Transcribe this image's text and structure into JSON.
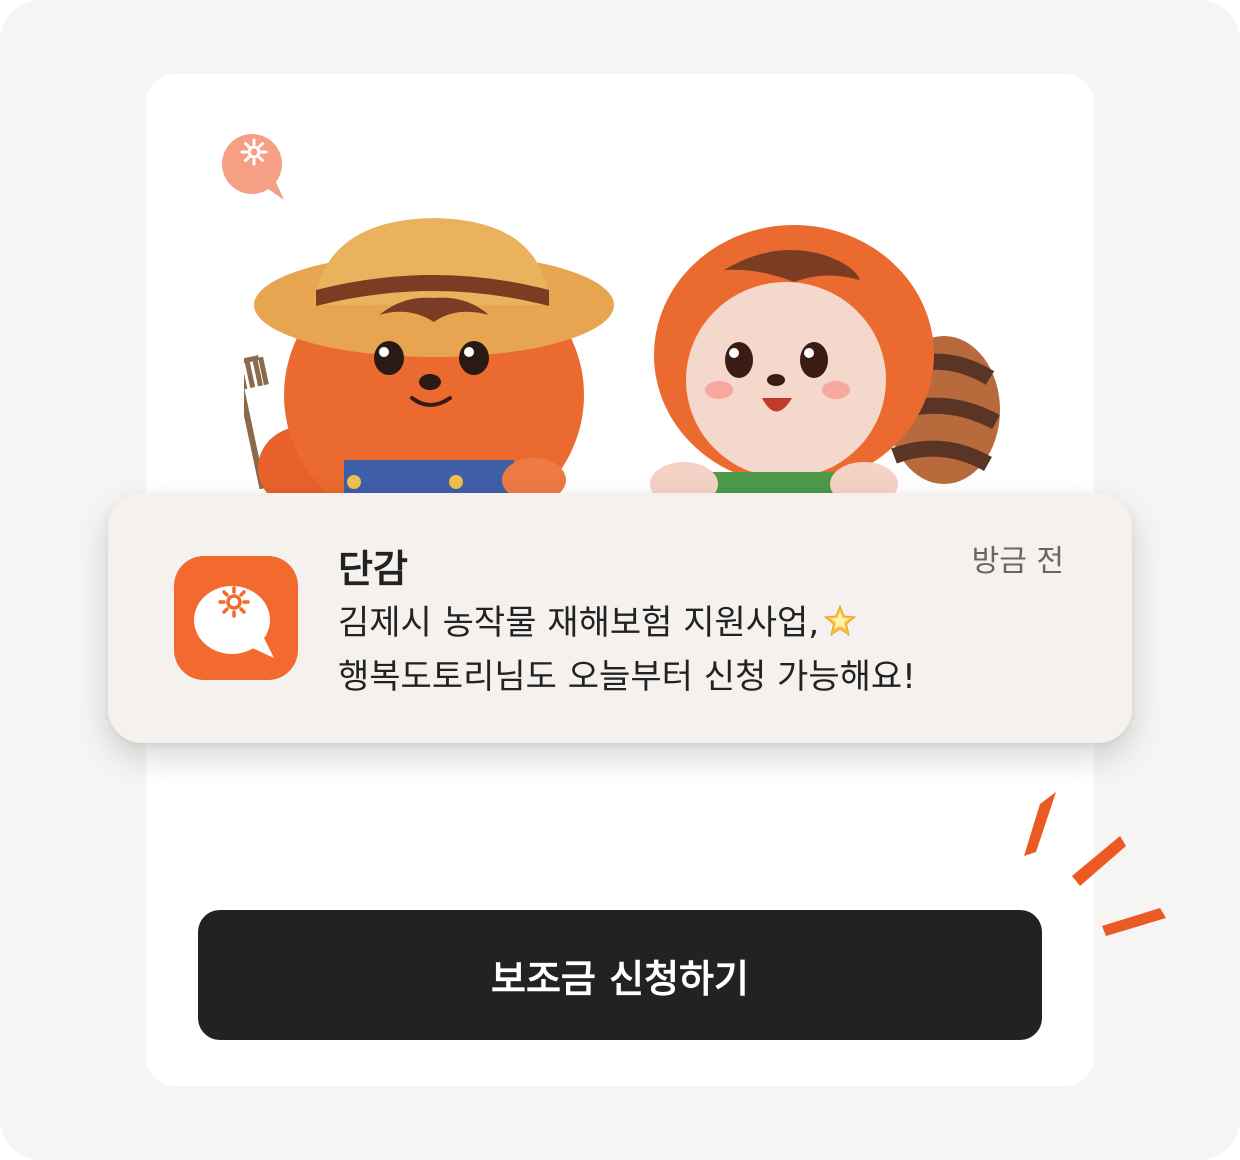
{
  "notification": {
    "app_name": "단감",
    "time": "방금 전",
    "message_line1": "김제시 농작물 재해보험 지원사업,",
    "message_line2": "행복도토리님도 오늘부터 신청 가능해요!",
    "emoji": "star-icon"
  },
  "cta": {
    "label": "보조금 신청하기"
  },
  "icons": {
    "app": "speech-bubble-sun-icon",
    "decoration": "speech-bubble-sun-icon"
  },
  "colors": {
    "brand_orange": "#f26a2e",
    "button_dark": "#222222",
    "notification_bg": "#f4f1ee",
    "page_bg": "#f6f5f3"
  }
}
